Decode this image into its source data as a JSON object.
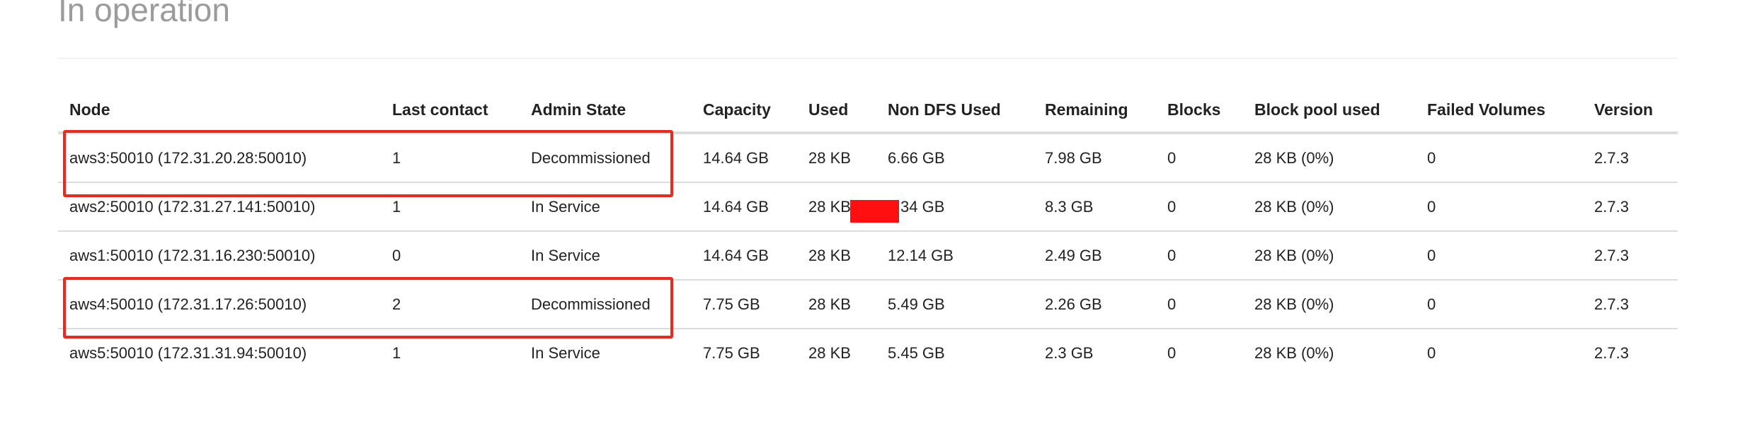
{
  "section": {
    "title": "In operation"
  },
  "table": {
    "columns": [
      "Node",
      "Last contact",
      "Admin State",
      "Capacity",
      "Used",
      "Non DFS Used",
      "Remaining",
      "Blocks",
      "Block pool used",
      "Failed Volumes",
      "Version"
    ],
    "rows": [
      {
        "node": "aws3:50010 (172.31.20.28:50010)",
        "last_contact": "1",
        "admin_state": "Decommissioned",
        "capacity": "14.64 GB",
        "used": "28 KB",
        "non_dfs_used": "6.66 GB",
        "remaining": "7.98 GB",
        "blocks": "0",
        "block_pool_used": "28 KB (0%)",
        "failed_volumes": "0",
        "version": "2.7.3",
        "highlighted": true
      },
      {
        "node": "aws2:50010 (172.31.27.141:50010)",
        "last_contact": "1",
        "admin_state": "In Service",
        "capacity": "14.64 GB",
        "used": "28 KB",
        "non_dfs_used": "34 GB",
        "remaining": "8.3 GB",
        "blocks": "0",
        "block_pool_used": "28 KB (0%)",
        "failed_volumes": "0",
        "version": "2.7.3",
        "highlighted": false
      },
      {
        "node": "aws1:50010 (172.31.16.230:50010)",
        "last_contact": "0",
        "admin_state": "In Service",
        "capacity": "14.64 GB",
        "used": "28 KB",
        "non_dfs_used": "12.14 GB",
        "remaining": "2.49 GB",
        "blocks": "0",
        "block_pool_used": "28 KB (0%)",
        "failed_volumes": "0",
        "version": "2.7.3",
        "highlighted": false
      },
      {
        "node": "aws4:50010 (172.31.17.26:50010)",
        "last_contact": "2",
        "admin_state": "Decommissioned",
        "capacity": "7.75 GB",
        "used": "28 KB",
        "non_dfs_used": "5.49 GB",
        "remaining": "2.26 GB",
        "blocks": "0",
        "block_pool_used": "28 KB (0%)",
        "failed_volumes": "0",
        "version": "2.7.3",
        "highlighted": true
      },
      {
        "node": "aws5:50010 (172.31.31.94:50010)",
        "last_contact": "1",
        "admin_state": "In Service",
        "capacity": "7.75 GB",
        "used": "28 KB",
        "non_dfs_used": "5.45 GB",
        "remaining": "2.3 GB",
        "blocks": "0",
        "block_pool_used": "28 KB (0%)",
        "failed_volumes": "0",
        "version": "2.7.3",
        "highlighted": false
      }
    ]
  },
  "colors": {
    "title": "#9b9b9b",
    "highlight_box": "#ea2a1f",
    "redaction": "#ff0f0f",
    "row_border": "#dddddd"
  }
}
